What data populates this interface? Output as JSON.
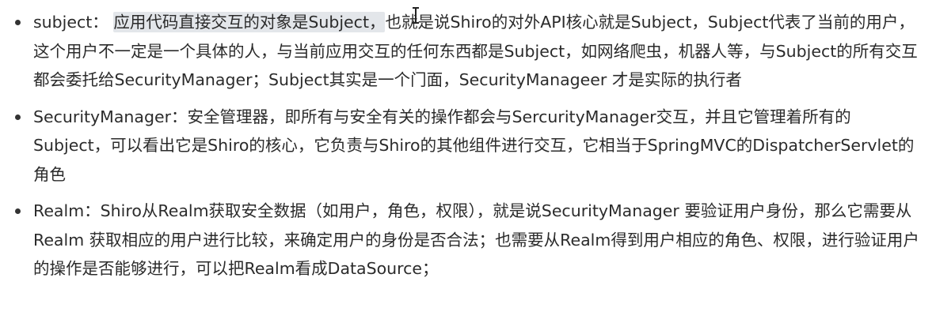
{
  "items": [
    {
      "term": "subject：",
      "highlight": "应用代码直接交互的对象是Subject，",
      "body": "也就是说Shiro的对外API核心就是Subject，Subject代表了当前的用户，这个用户不一定是一个具体的人，与当前应用交互的任何东西都是Subject，如网络爬虫，机器人等，与Subject的所有交互都会委托给SecurityManager；Subject其实是一个门面，SecurityManageer 才是实际的执行者"
    },
    {
      "term": "SecurityManager：",
      "body": "安全管理器，即所有与安全有关的操作都会与SercurityManager交互，并且它管理着所有的Subject，可以看出它是Shiro的核心，它负责与Shiro的其他组件进行交互，它相当于SpringMVC的DispatcherServlet的角色"
    },
    {
      "term": "Realm：",
      "body": "Shiro从Realm获取安全数据（如用户，角色，权限），就是说SecurityManager 要验证用户身份，那么它需要从Realm 获取相应的用户进行比较，来确定用户的身份是否合法；也需要从Realm得到用户相应的角色、权限，进行验证用户的操作是否能够进行，可以把Realm看成DataSource；"
    }
  ]
}
